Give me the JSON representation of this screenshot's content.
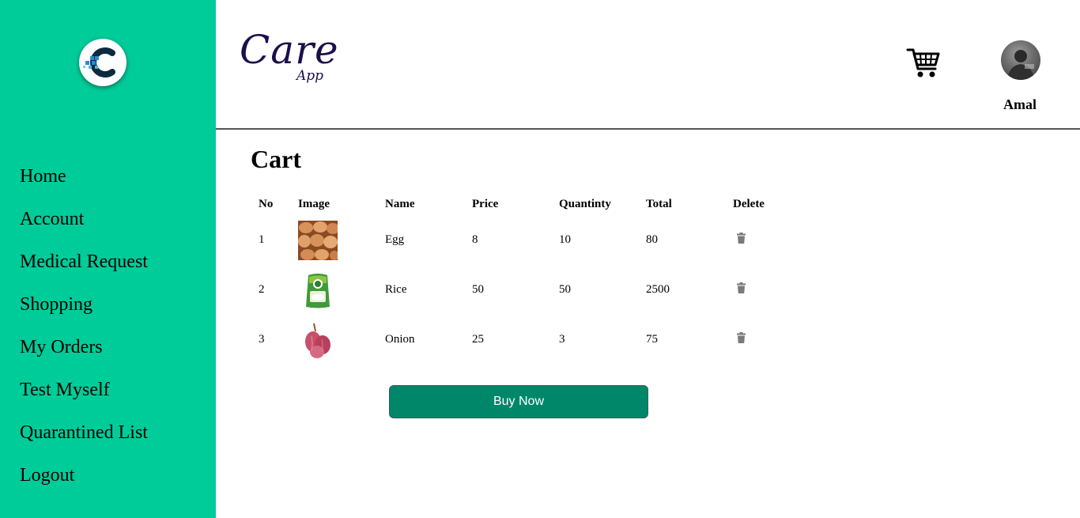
{
  "sidebar": {
    "logo_icon": "care-app-c-logo-icon",
    "background": "#00cc99",
    "items": [
      {
        "label": "Home"
      },
      {
        "label": "Account"
      },
      {
        "label": "Medical Request"
      },
      {
        "label": "Shopping"
      },
      {
        "label": "My Orders"
      },
      {
        "label": "Test Myself"
      },
      {
        "label": "Quarantined List"
      },
      {
        "label": "Logout"
      }
    ]
  },
  "header": {
    "brand_main": "Care",
    "brand_sub": "App",
    "cart_icon": "shopping-cart-icon",
    "user_name": "Amal"
  },
  "main": {
    "title": "Cart",
    "columns": [
      "No",
      "Image",
      "Name",
      "Price",
      "Quantinty",
      "Total",
      "Delete"
    ],
    "rows": [
      {
        "no": "1",
        "image": "egg",
        "name": "Egg",
        "price": "8",
        "quantity": "10",
        "total": "80"
      },
      {
        "no": "2",
        "image": "rice-bag",
        "name": "Rice",
        "price": "50",
        "quantity": "50",
        "total": "2500"
      },
      {
        "no": "3",
        "image": "onion",
        "name": "Onion",
        "price": "25",
        "quantity": "3",
        "total": "75"
      }
    ],
    "delete_icon": "trash-icon",
    "buy_label": "Buy Now",
    "buy_color": "#00876a"
  }
}
